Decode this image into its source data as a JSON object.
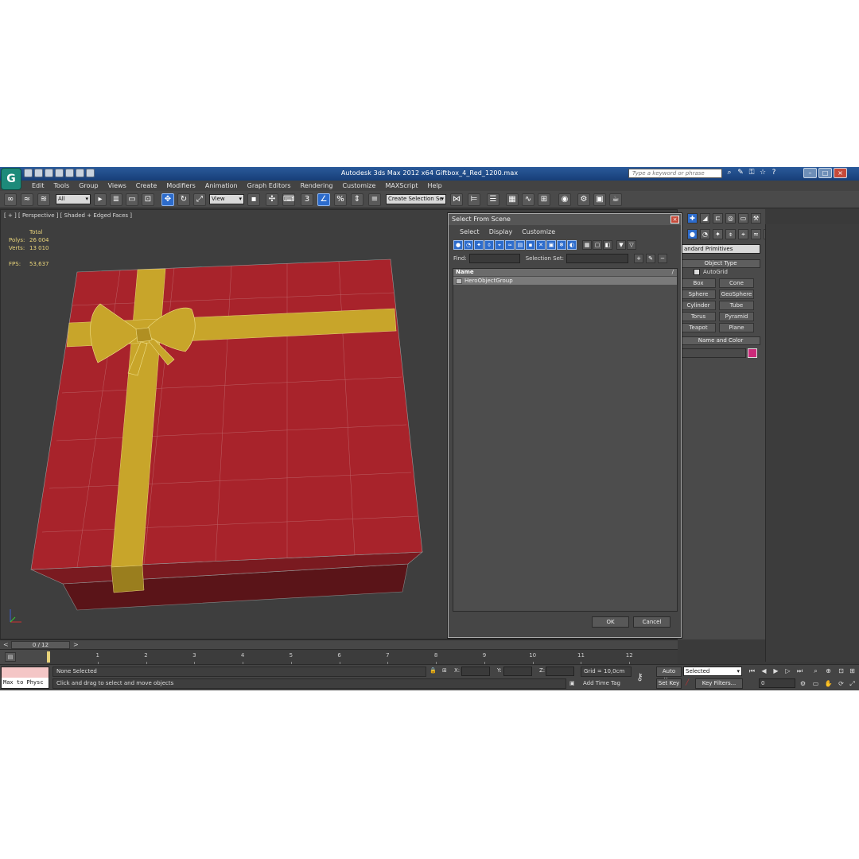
{
  "window": {
    "app_title": "Autodesk 3ds Max  2012 x64     Giftbox_4_Red_1200.max",
    "help_search_placeholder": "Type a keyword or phrase",
    "logo": "3ds-max-logo"
  },
  "menu": [
    "Edit",
    "Tools",
    "Group",
    "Views",
    "Create",
    "Modifiers",
    "Animation",
    "Graph Editors",
    "Rendering",
    "Customize",
    "MAXScript",
    "Help"
  ],
  "toolbar": {
    "filter_select": "All",
    "ref_coord_select": "View",
    "selection_set_placeholder": "Create Selection Se"
  },
  "viewport": {
    "label": "[ + ] [ Perspective ] [ Shaded + Edged Faces ]",
    "stats": {
      "total_label": "Total",
      "polys_label": "Polys:",
      "polys_value": "26 004",
      "verts_label": "Verts:",
      "verts_value": "13 010",
      "fps_label": "FPS:",
      "fps_value": "53,637"
    },
    "colors": {
      "box": "#a8232b",
      "ribbon": "#c8a52a"
    }
  },
  "command_panel": {
    "primitive_type": "andard Primitives",
    "object_type_header": "Object Type",
    "autogrid_label": "AutoGrid",
    "primitives": [
      "Box",
      "Cone",
      "Sphere",
      "GeoSphere",
      "Cylinder",
      "Tube",
      "Torus",
      "Pyramid",
      "Teapot",
      "Plane"
    ],
    "name_color_header": "Name and Color",
    "swatch_color": "#cc2a7a"
  },
  "dialog": {
    "title": "Select From Scene",
    "menu": [
      "Select",
      "Display",
      "Customize"
    ],
    "find_label": "Find:",
    "selection_set_label": "Selection Set:",
    "column_name": "Name",
    "items": [
      "HeroObjectGroup"
    ],
    "ok_label": "OK",
    "cancel_label": "Cancel"
  },
  "timeline": {
    "frame_display": "0 / 12",
    "ticks": [
      "1",
      "2",
      "3",
      "4",
      "5",
      "6",
      "7",
      "8",
      "9",
      "10",
      "11",
      "12"
    ]
  },
  "status": {
    "maxscript_text": "Max to Physc",
    "selection_status": "None Selected",
    "prompt": "Click and drag to select and move objects",
    "x_label": "X:",
    "y_label": "Y:",
    "z_label": "Z:",
    "grid": "Grid = 10,0cm",
    "add_time_tag": "Add Time Tag",
    "auto_key": "Auto Key",
    "set_key": "Set Key",
    "selected_dropdown": "Selected",
    "key_filters": "Key Filters...",
    "current_frame": "0"
  }
}
